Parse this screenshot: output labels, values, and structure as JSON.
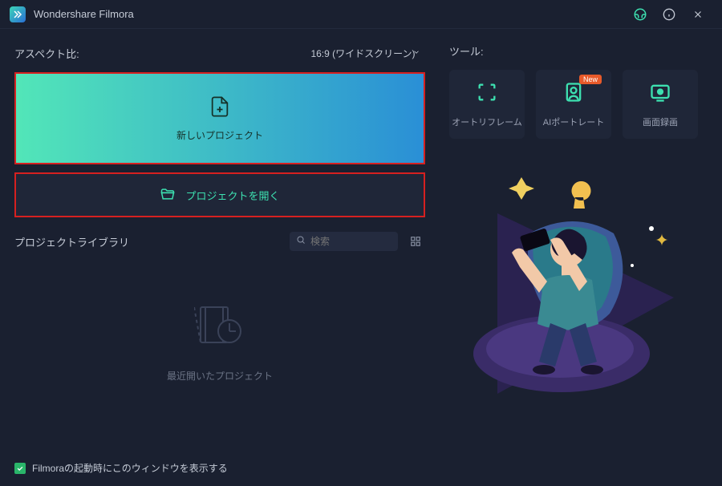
{
  "titlebar": {
    "app_name": "Wondershare Filmora"
  },
  "left_panel": {
    "aspect_label": "アスペクト比:",
    "aspect_value": "16:9 (ワイドスクリーン)",
    "new_project": "新しいプロジェクト",
    "open_project": "プロジェクトを開く",
    "library_label": "プロジェクトライブラリ",
    "search_placeholder": "検索",
    "recent_label": "最近開いたプロジェクト"
  },
  "right_panel": {
    "tools_label": "ツール:",
    "tools": [
      {
        "label": "オートリフレーム",
        "badge": null
      },
      {
        "label": "AIポートレート",
        "badge": "New"
      },
      {
        "label": "画面録画",
        "badge": null
      }
    ]
  },
  "footer": {
    "show_on_startup": "Filmoraの起動時にこのウィンドウを表示する",
    "checked": true
  }
}
